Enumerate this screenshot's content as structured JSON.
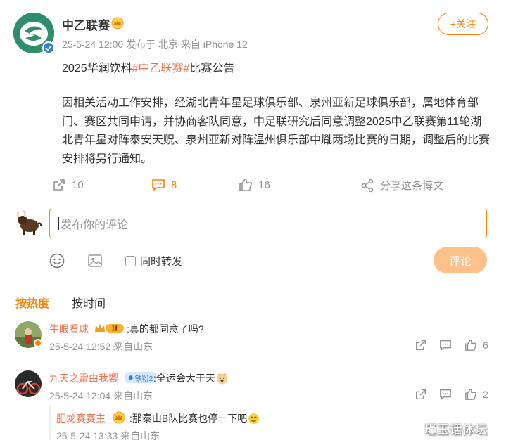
{
  "post": {
    "author": "中乙联赛",
    "time": "25-5-24 12:00",
    "location": "发布于 北京",
    "device": "来自 iPhone 12",
    "follow_label": "+关注",
    "title_prefix": "2025华润饮料",
    "title_hashtag": "#中乙联赛#",
    "title_suffix": "比赛公告",
    "body": "因相关活动工作安排，经湖北青年星足球俱乐部、泉州亚新足球俱乐部，属地体育部门、赛区共同申请，并协商客队同意，中足联研究后同意调整2025中乙联赛第11轮湖北青年星对阵泰安天贶、泉州亚新对阵温州俱乐部中胤两场比赛的日期，调整后的比赛安排将另行通知。"
  },
  "actions": {
    "repost_count": "10",
    "comment_count": "8",
    "like_count": "16",
    "share_label": "分享这条博文"
  },
  "composer": {
    "placeholder": "发布你的评论",
    "repost_label": "同时转发",
    "submit_label": "评论"
  },
  "sort_tabs": {
    "hot": "按热度",
    "time": "按时间"
  },
  "comments": [
    {
      "name": "牛眼看球",
      "badge": "II",
      "text": ":真的都同意了吗?",
      "time": "25-5-24 12:52",
      "location": "来自山东",
      "likes": "6"
    },
    {
      "name": "九天之雷由我響",
      "badge": "铁粉2",
      "text": ":全运会大于天",
      "time": "25-5-24 12:04",
      "location": "来自山东",
      "likes": "2"
    }
  ],
  "reply": {
    "name": "肥龙赛赛主",
    "text": ":那泰山B队比赛也停一下吧",
    "time": "25-5-24 13:33",
    "location": "来自山东"
  },
  "watermark": "瑾玉话体坛",
  "colors": {
    "accent": "#ff8200",
    "hashtag": "#eb7350",
    "meta": "#939393",
    "submit_disabled": "#ffc08a"
  }
}
